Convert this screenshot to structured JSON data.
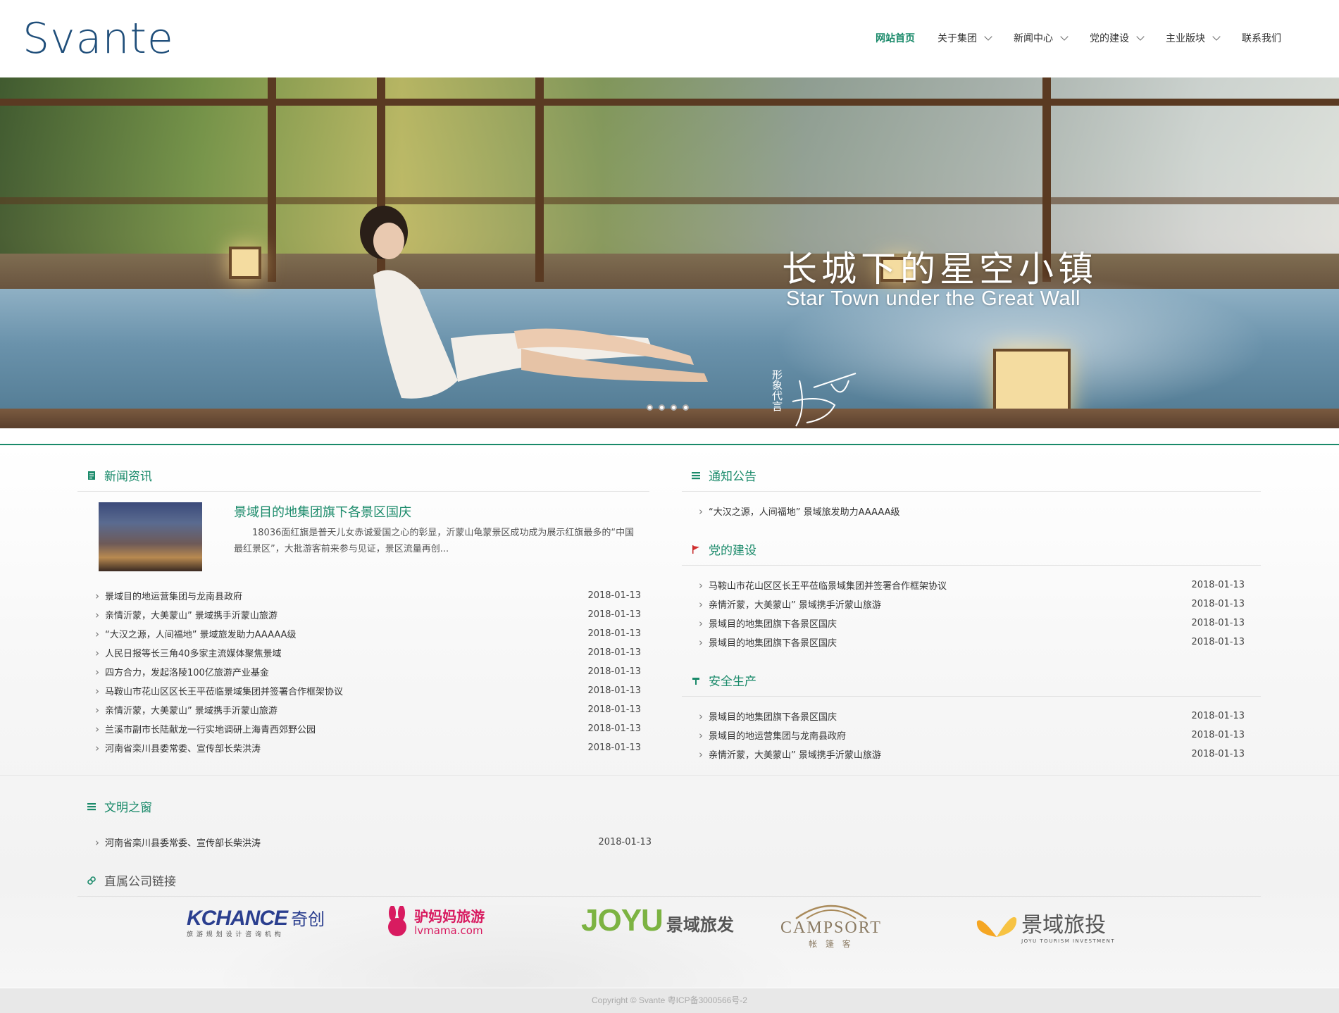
{
  "header": {
    "logo": "Svante",
    "nav": [
      {
        "label": "网站首页",
        "active": true,
        "has_dropdown": false
      },
      {
        "label": "关于集团",
        "active": false,
        "has_dropdown": true
      },
      {
        "label": "新闻中心",
        "active": false,
        "has_dropdown": true
      },
      {
        "label": "党的建设",
        "active": false,
        "has_dropdown": true
      },
      {
        "label": "主业版块",
        "active": false,
        "has_dropdown": true
      },
      {
        "label": "联系我们",
        "active": false,
        "has_dropdown": false
      }
    ]
  },
  "banner": {
    "title": "长城下的星空小镇",
    "subtitle": "Star Town under the Great Wall",
    "mark_text": "形象代言",
    "slides": 4,
    "active_slide": 1
  },
  "news": {
    "title": "新闻资讯",
    "featured": {
      "title": "景域目的地集团旗下各景区国庆",
      "summary": "18036面红旗是普天儿女赤诚爱国之心的彰显，沂蒙山龟蒙景区成功成为展示红旗最多的“中国最红景区”，大批游客前来参与见证，景区流量再创..."
    },
    "items": [
      {
        "text": "景域目的地运营集团与龙南县政府",
        "date": "2018-01-13"
      },
      {
        "text": "亲情沂蒙，大美蒙山” 景域携手沂蒙山旅游",
        "date": "2018-01-13"
      },
      {
        "text": "“大汉之源，人间福地” 景域旅发助力AAAAA级",
        "date": "2018-01-13"
      },
      {
        "text": "人民日报等长三角40多家主流媒体聚焦景域",
        "date": "2018-01-13"
      },
      {
        "text": "四方合力，发起洛陵100亿旅游产业基金",
        "date": "2018-01-13"
      },
      {
        "text": "马鞍山市花山区区长王平莅临景域集团并签署合作框架协议",
        "date": "2018-01-13"
      },
      {
        "text": "亲情沂蒙，大美蒙山” 景域携手沂蒙山旅游",
        "date": "2018-01-13"
      },
      {
        "text": "兰溪市副市长陆献龙一行实地调研上海青西郊野公园",
        "date": "2018-01-13"
      },
      {
        "text": "河南省栾川县委常委、宣传部长柴洪涛",
        "date": "2018-01-13"
      }
    ]
  },
  "notice": {
    "title": "通知公告",
    "items": [
      {
        "text": "“大汉之源，人间福地” 景域旅发助力AAAAA级"
      }
    ]
  },
  "party": {
    "title": "党的建设",
    "items": [
      {
        "text": "马鞍山市花山区区长王平莅临景域集团并签署合作框架协议",
        "date": "2018-01-13"
      },
      {
        "text": "亲情沂蒙，大美蒙山” 景域携手沂蒙山旅游",
        "date": "2018-01-13"
      },
      {
        "text": "景域目的地集团旗下各景区国庆",
        "date": "2018-01-13"
      },
      {
        "text": "景域目的地集团旗下各景区国庆",
        "date": "2018-01-13"
      }
    ]
  },
  "safety": {
    "title": "安全生产",
    "items": [
      {
        "text": "景域目的地集团旗下各景区国庆",
        "date": "2018-01-13"
      },
      {
        "text": "景域目的地运营集团与龙南县政府",
        "date": "2018-01-13"
      },
      {
        "text": "亲情沂蒙，大美蒙山” 景域携手沂蒙山旅游",
        "date": "2018-01-13"
      }
    ]
  },
  "civilization": {
    "title": "文明之窗",
    "items": [
      {
        "text": "河南省栾川县委常委、宣传部长柴洪涛",
        "date": "2018-01-13"
      }
    ]
  },
  "links": {
    "title": "直属公司链接",
    "partners": [
      {
        "name": "KCHANCE",
        "cn": "奇创",
        "tagline": "旅 游 规 划 设 计 咨 询 机 构"
      },
      {
        "name": "驴妈妈旅游",
        "sub": "lvmama.com"
      },
      {
        "name": "JOYU",
        "cn": "景域旅发"
      },
      {
        "name": "CAMPSORT",
        "cn": "帐 篷 客"
      },
      {
        "name": "景域旅投",
        "tagline": "JOYU TOURISM INVESTMENT"
      }
    ]
  },
  "footer": {
    "text": "Copyright © Svante    粤ICP备3000566号-2"
  },
  "colors": {
    "accent": "#1a8a6a",
    "logo": "#1f4e7a",
    "footer_bg": "#e8e8e8"
  }
}
